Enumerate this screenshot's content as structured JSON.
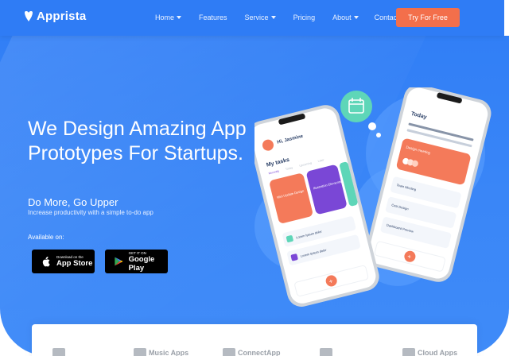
{
  "brand": {
    "name": "Apprista",
    "icon": "heart-icon"
  },
  "nav": {
    "items": [
      {
        "label": "Home",
        "dropdown": true
      },
      {
        "label": "Features",
        "dropdown": false
      },
      {
        "label": "Service",
        "dropdown": true
      },
      {
        "label": "Pricing",
        "dropdown": false
      },
      {
        "label": "About",
        "dropdown": true
      },
      {
        "label": "Contact",
        "dropdown": false
      }
    ],
    "cta_label": "Try For Free"
  },
  "hero": {
    "headline": "We Design Amazing App Prototypes For Startups.",
    "subhead": "Do More, Go Upper",
    "tagline": "Increase productivity with a simple to-do app",
    "available_label": "Available on:",
    "app_store": {
      "small": "Download on the",
      "big": "App Store",
      "icon": "apple-icon"
    },
    "google_play": {
      "small": "GET IT ON",
      "big": "Google Play",
      "icon": "play-icon"
    }
  },
  "phones": {
    "front": {
      "greeting": "Hi, Jasmine",
      "section_title": "My tasks",
      "tabs": [
        "Recently",
        "Today",
        "Upcoming",
        "Later"
      ],
      "cards": [
        "Mini Update Design",
        "Illustration Elements"
      ],
      "list_items": [
        "Lorem Ipsum dolor",
        "Lorem Ipsum dolor"
      ]
    },
    "back": {
      "title": "Today",
      "card_title": "Design meeting",
      "list_items": [
        "Team Meeting",
        "Cost Design",
        "Dashboard Preview"
      ]
    },
    "calendar_badge_icon": "calendar-icon"
  },
  "partners": [
    "Music Apps",
    "ConnectApp",
    "Cloud Apps"
  ],
  "colors": {
    "hero_blue": "#2f7df6",
    "cta_orange": "#f36f4b",
    "card_orange": "#f47a5a",
    "card_purple": "#7a47d6",
    "badge_teal": "#5ed6b8"
  }
}
